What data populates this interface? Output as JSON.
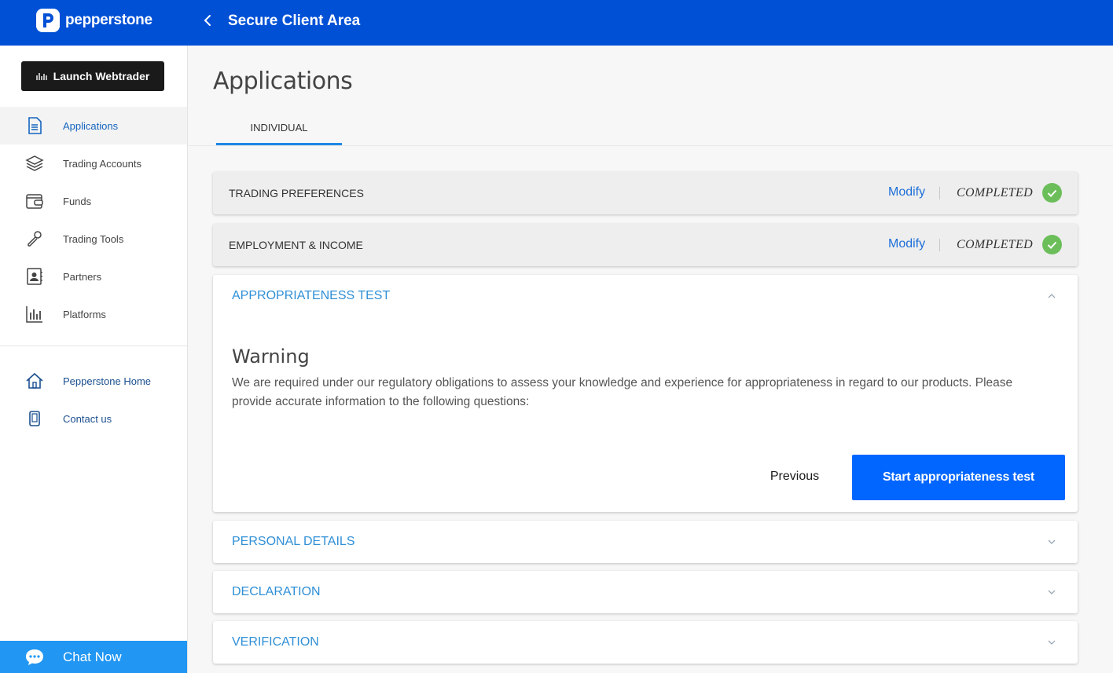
{
  "brand": {
    "name": "pepperstone",
    "accent": "#0050d6"
  },
  "header": {
    "title": "Secure Client Area"
  },
  "sidebar": {
    "launch_label": "Launch Webtrader",
    "items": [
      {
        "label": "Applications",
        "icon": "document-icon"
      },
      {
        "label": "Trading Accounts",
        "icon": "layers-icon"
      },
      {
        "label": "Funds",
        "icon": "wallet-icon"
      },
      {
        "label": "Trading Tools",
        "icon": "wrench-icon"
      },
      {
        "label": "Partners",
        "icon": "contact-card-icon"
      },
      {
        "label": "Platforms",
        "icon": "bar-chart-icon"
      }
    ],
    "links": [
      {
        "label": "Pepperstone Home",
        "icon": "home-icon"
      },
      {
        "label": "Contact us",
        "icon": "phone-icon"
      }
    ],
    "chat_label": "Chat Now"
  },
  "main": {
    "title": "Applications",
    "tab": "INDIVIDUAL",
    "sections": [
      {
        "title": "TRADING PREFERENCES",
        "action": "Modify",
        "status": "COMPLETED"
      },
      {
        "title": "EMPLOYMENT & INCOME",
        "action": "Modify",
        "status": "COMPLETED"
      },
      {
        "title": "APPROPRIATENESS TEST"
      },
      {
        "title": "PERSONAL DETAILS"
      },
      {
        "title": "DECLARATION"
      },
      {
        "title": "VERIFICATION"
      }
    ],
    "warning": {
      "title": "Warning",
      "text": "We are required under our regulatory obligations to assess your knowledge and experience for appropriateness in regard to our products. Please provide accurate information to the following questions:"
    },
    "previous_label": "Previous",
    "start_label": "Start appropriateness test"
  }
}
